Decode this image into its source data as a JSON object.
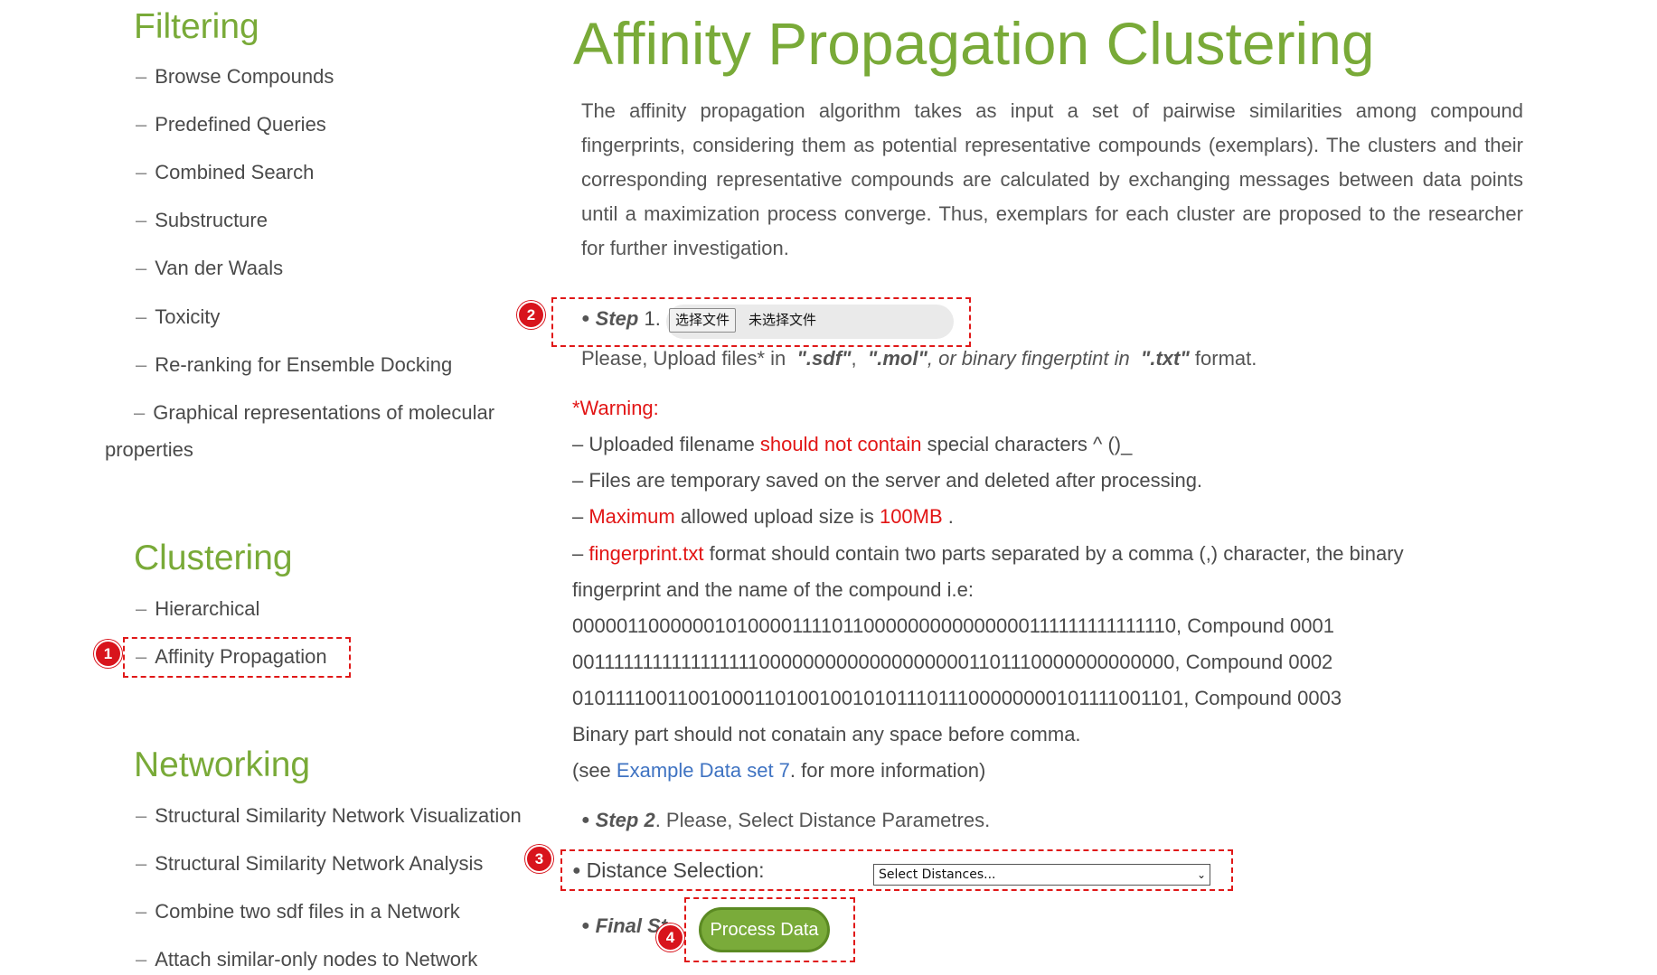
{
  "sidebar": {
    "filtering": {
      "title": "Filtering",
      "items": [
        "Browse Compounds",
        "Predefined Queries",
        "Combined Search",
        "Substructure",
        "Van der Waals",
        "Toxicity",
        "Re-ranking for Ensemble Docking"
      ],
      "graphical_line1": "Graphical representations of molecular",
      "graphical_line2": "properties"
    },
    "clustering": {
      "title": "Clustering",
      "items": [
        "Hierarchical",
        "Affinity Propagation"
      ]
    },
    "networking": {
      "title": "Networking",
      "items": [
        "Structural Similarity Network Visualization",
        "Structural Similarity Network Analysis",
        "Combine two sdf files in a Network",
        "Attach similar-only nodes to Network"
      ]
    },
    "dash": "–"
  },
  "main": {
    "title": "Affinity Propagation Clustering",
    "description": "The affinity propagation algorithm takes as input a set of pairwise similarities among compound fingerprints, considering them as potential representative compounds (exemplars). The clusters and their corresponding representative compounds are calculated by exchanging messages between data points until a maximization process converge. Thus, exemplars for each cluster are proposed to the researcher for further investigation.",
    "step1": {
      "label": "Step",
      "number": "1.",
      "file_button": "选择文件",
      "file_status": "未选择文件",
      "upload_pre": "Please, Upload files",
      "upload_star": "*",
      "upload_in": " in  ",
      "sdf": "\".sdf\"",
      "comma1": ",  ",
      "mol": "\".mol\"",
      "or_binary": ", or binary fingerptint in  ",
      "txt": "\".txt\"",
      "format": " format."
    },
    "warning": {
      "title": "*Warning:",
      "line1_pre": "– Uploaded filename ",
      "line1_red": "should not contain",
      "line1_post": " special characters ^ ()_",
      "line2": "– Files are temporary saved on the server and deleted after processing.",
      "line3_pre": "– ",
      "line3_red1": "Maximum",
      "line3_mid": " allowed upload size is ",
      "line3_red2": "100MB",
      "line3_post": " .",
      "line4_pre": "– ",
      "line4_red": "fingerprint.txt",
      "line4_post": " format should contain two parts separated by a comma (,) character, the binary",
      "line5": "fingerprint and the name of the compound i.e:",
      "examples": [
        "000001100000010100001111011000000000000000111111111111110, Compound 0001",
        "001111111111111111100000000000000000001101110000000000000, Compound 0002",
        "010111100110010001101001001010111011100000000101111001101, Compound 0003"
      ],
      "binary_note": "Binary part should not conatain any space before comma.",
      "see_pre": "(see ",
      "see_link": "Example Data set 7",
      "see_post": ". for more information)"
    },
    "step2": {
      "label": "Step 2",
      "text": ". Please, Select Distance Parametres."
    },
    "distance": {
      "label": "Distance Selection:",
      "select_value": "Select Distances..."
    },
    "final": {
      "label": "Final St",
      "period": ".",
      "button": "Process Data"
    }
  },
  "annotations": [
    "1",
    "2",
    "3",
    "4"
  ],
  "colors": {
    "accent": "#79aa38",
    "warning": "#e21515",
    "link": "#3f73c2",
    "annotation": "#d8141c"
  }
}
